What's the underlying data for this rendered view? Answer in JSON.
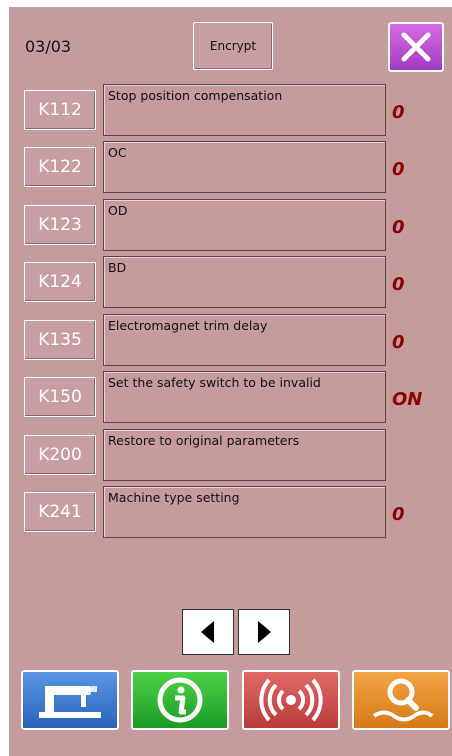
{
  "header": {
    "page_indicator": "03/03",
    "encrypt_label": "Encrypt"
  },
  "params": [
    {
      "code": "K112",
      "description": "Stop position compensation",
      "value": "0"
    },
    {
      "code": "K122",
      "description": "OC",
      "value": "0"
    },
    {
      "code": "K123",
      "description": "OD",
      "value": "0"
    },
    {
      "code": "K124",
      "description": "BD",
      "value": "0"
    },
    {
      "code": "K135",
      "description": "Electromagnet trim delay",
      "value": "0"
    },
    {
      "code": "K150",
      "description": "Set the safety switch to be invalid",
      "value": "ON"
    },
    {
      "code": "K200",
      "description": "Restore to original parameters",
      "value": ""
    },
    {
      "code": "K241",
      "description": "Machine type setting",
      "value": "0"
    }
  ],
  "pagination": {
    "prev_icon": "triangle-left-icon",
    "next_icon": "triangle-right-icon"
  },
  "bottom_nav": [
    {
      "name": "sewing-machine-icon",
      "color": "#3a78d0"
    },
    {
      "name": "info-icon",
      "color": "#1faa2a"
    },
    {
      "name": "signal-broadcast-icon",
      "color": "#c24a48"
    },
    {
      "name": "search-icon",
      "color": "#e08a1e"
    }
  ],
  "colors": {
    "background": "#c59b9e",
    "value_text": "#8b0000",
    "close_button": "#b84fd4"
  }
}
